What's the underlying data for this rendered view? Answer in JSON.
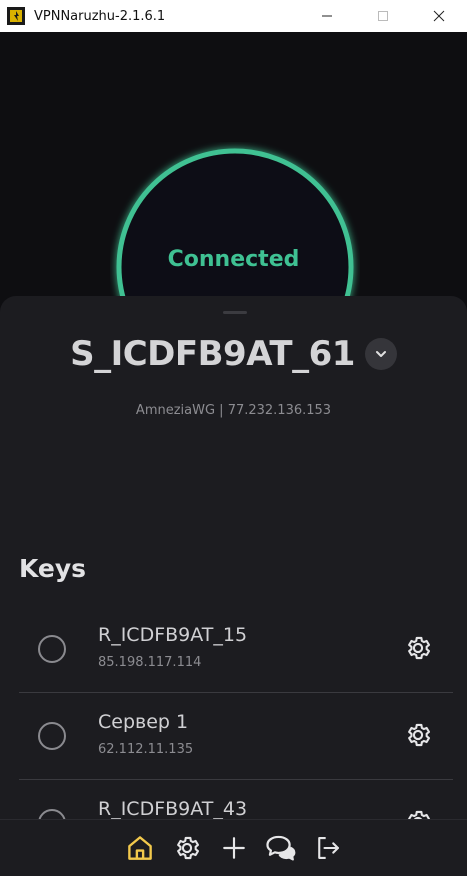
{
  "window": {
    "title": "VPNNaruzhu-2.1.6.1"
  },
  "connection": {
    "status": "Connected",
    "ring_color": "#3fc193"
  },
  "server": {
    "name": "S_ICDFB9AT_61",
    "subtitle": "AmneziaWG | 77.232.136.153"
  },
  "keys": {
    "title": "Keys",
    "items": [
      {
        "name": "R_ICDFB9AT_15",
        "ip": "85.198.117.114"
      },
      {
        "name": "Сервер 1",
        "ip": "62.112.11.135"
      },
      {
        "name": "R_ICDFB9AT_43",
        "ip": ""
      }
    ]
  },
  "nav": {
    "items": [
      "home-icon",
      "settings-icon",
      "add-icon",
      "support-chat-icon",
      "logout-icon"
    ],
    "active": "home-icon",
    "active_color": "#f2c94c"
  }
}
